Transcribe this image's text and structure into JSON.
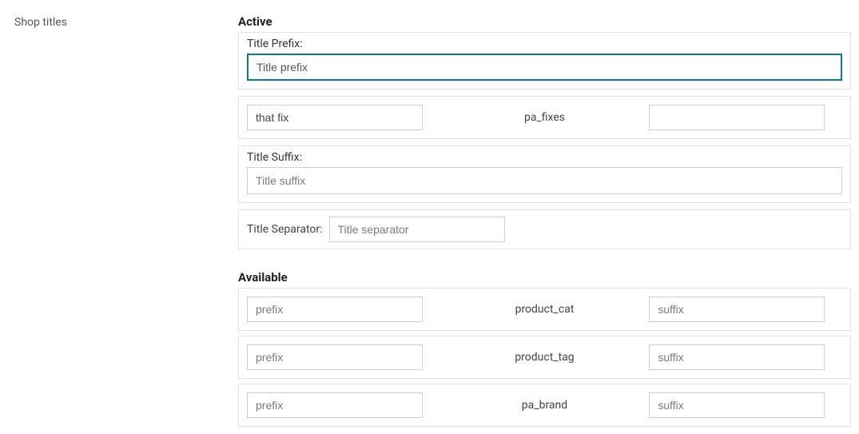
{
  "sidebar": {
    "label": "Shop titles"
  },
  "active": {
    "heading": "Active",
    "prefix": {
      "label": "Title Prefix:",
      "value": "Title prefix"
    },
    "triple": {
      "prefix_value": "that fix",
      "center_label": "pa_fixes",
      "suffix_value": ""
    },
    "suffix": {
      "label": "Title Suffix:",
      "placeholder": "Title suffix",
      "value": ""
    },
    "separator": {
      "label": "Title Separator:",
      "placeholder": "Title separator",
      "value": ""
    }
  },
  "available": {
    "heading": "Available",
    "rows": [
      {
        "prefix_placeholder": "prefix",
        "center_label": "product_cat",
        "suffix_placeholder": "suffix"
      },
      {
        "prefix_placeholder": "prefix",
        "center_label": "product_tag",
        "suffix_placeholder": "suffix"
      },
      {
        "prefix_placeholder": "prefix",
        "center_label": "pa_brand",
        "suffix_placeholder": "suffix"
      }
    ]
  }
}
